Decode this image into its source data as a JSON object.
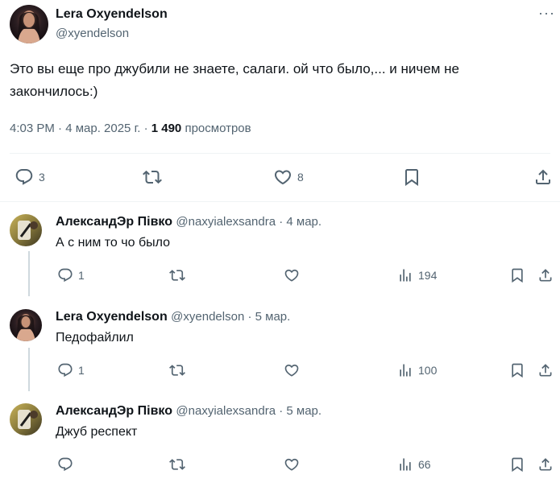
{
  "main_tweet": {
    "author": "Lera Oxyendelson",
    "handle": "@xyendelson",
    "more": "···",
    "text": "Это вы еще про джубили не знаете, салаги. ой что было,... и ничем не закончилось:)",
    "timestamp": "4:03 PM · 4 мар. 2025 г.",
    "separator": "·",
    "views_count": "1 490",
    "views_label": "просмотров",
    "actions": {
      "replies": "3",
      "reposts": "",
      "likes": "8"
    }
  },
  "replies": [
    {
      "author": "АлександЭр Півко",
      "handle": "@naxyialexsandra · 4 мар.",
      "text": "А с ним то чо было",
      "reply_count": "1",
      "views": "194"
    },
    {
      "author": "Lera Oxyendelson",
      "handle": "@xyendelson · 5 мар.",
      "text": "Педофайлил",
      "reply_count": "1",
      "views": "100"
    },
    {
      "author": "АлександЭр Півко",
      "handle": "@naxyialexsandra · 5 мар.",
      "text": "Джуб респект",
      "reply_count": "",
      "views": "66"
    }
  ],
  "icons": {
    "reply": "reply-icon",
    "repost": "repost-icon",
    "like": "like-icon",
    "views": "views-icon",
    "bookmark": "bookmark-icon",
    "share": "share-icon"
  },
  "colors": {
    "text": "#0f1419",
    "secondary": "#536471",
    "divider": "#eff3f4",
    "thread_line": "#cfd9de"
  }
}
